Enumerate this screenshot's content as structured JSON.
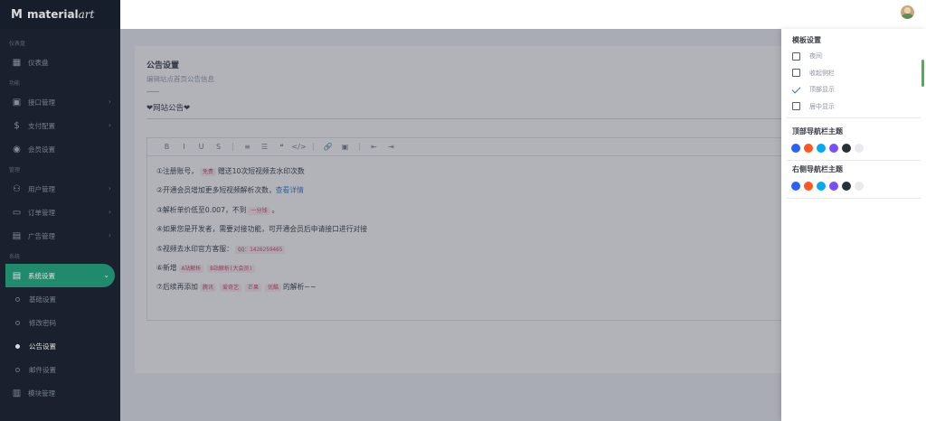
{
  "brand": {
    "mark": "M",
    "name_bold": "material",
    "name_script": "art"
  },
  "sidebar": {
    "sections": [
      {
        "label": "仪表盘",
        "items": [
          {
            "label": "仪表盘",
            "icon": "dashboard-icon"
          }
        ]
      },
      {
        "label": "功能",
        "items": [
          {
            "label": "接口管理",
            "icon": "monitor-icon",
            "chevron": "›"
          },
          {
            "label": "支付配置",
            "icon": "dollar-icon",
            "chevron": "›"
          },
          {
            "label": "会员设置",
            "icon": "vip-icon"
          }
        ]
      },
      {
        "label": "管理",
        "items": [
          {
            "label": "用户管理",
            "icon": "users-icon",
            "chevron": "›"
          },
          {
            "label": "订单管理",
            "icon": "card-icon",
            "chevron": "›"
          },
          {
            "label": "广告管理",
            "icon": "ad-icon",
            "chevron": "›"
          }
        ]
      },
      {
        "label": "系统",
        "items": [
          {
            "label": "系统设置",
            "icon": "document-icon",
            "chevron": "⌄",
            "active": true
          }
        ]
      }
    ],
    "subitems": [
      {
        "label": "基础设置"
      },
      {
        "label": "修改密码"
      },
      {
        "label": "公告设置",
        "current": true
      },
      {
        "label": "邮件设置"
      }
    ],
    "last_item": {
      "label": "模块管理",
      "icon": "module-icon"
    }
  },
  "card": {
    "title": "公告设置",
    "subtitle": "编辑站点首页公告信息",
    "notice_value": "❤网站公告❤"
  },
  "editor": {
    "toolbar": [
      "B",
      "I",
      "U",
      "S",
      "|",
      "≡",
      "☰",
      "❝",
      "</>",
      "|",
      "🔗",
      "▣",
      "|",
      "⇤",
      "⇥"
    ],
    "lines": [
      {
        "parts": [
          {
            "t": "①注册账号，"
          },
          {
            "t": "免费",
            "code": true
          },
          {
            "t": "赠送10次短视频去水印次数"
          }
        ]
      },
      {
        "parts": [
          {
            "t": "②开通会员增加更多短视频解析次数，"
          },
          {
            "t": "查看详情",
            "link": true
          }
        ]
      },
      {
        "parts": [
          {
            "t": "③解析单价低至0.007，不到"
          },
          {
            "t": "一分钱",
            "code": true
          },
          {
            "t": "。"
          }
        ]
      },
      {
        "parts": [
          {
            "t": "④如果您是开发者，需要对接功能，可开通会员后申请接口进行对接"
          }
        ]
      },
      {
        "parts": [
          {
            "t": "⑤视频去水印官方客服："
          },
          {
            "t": "QQ：1426259465",
            "code": true
          }
        ]
      },
      {
        "parts": [
          {
            "t": "⑥新增"
          },
          {
            "t": "A站解析",
            "code": true
          },
          {
            "t": "B站解析(大会员)",
            "code": true
          }
        ]
      },
      {
        "parts": [
          {
            "t": "⑦后续再添加"
          },
          {
            "t": "腾讯",
            "code": true
          },
          {
            "t": "爱奇艺",
            "code": true
          },
          {
            "t": "芒果",
            "code": true
          },
          {
            "t": "优酷",
            "code": true
          },
          {
            "t": "的解析~~"
          }
        ]
      }
    ]
  },
  "panel": {
    "title": "模板设置",
    "options": [
      {
        "label": "夜间",
        "checked": false
      },
      {
        "label": "收起侧栏",
        "checked": false
      },
      {
        "label": "顶部显示",
        "checked": true
      },
      {
        "label": "居中显示",
        "checked": false
      }
    ],
    "top_theme_title": "顶部导航栏主题",
    "right_theme_title": "右侧导航栏主题",
    "swatch_colors": [
      "#2962ff",
      "#ff5722",
      "#03a9f4",
      "#7c4dff",
      "#263238",
      "#e8eaed"
    ]
  }
}
